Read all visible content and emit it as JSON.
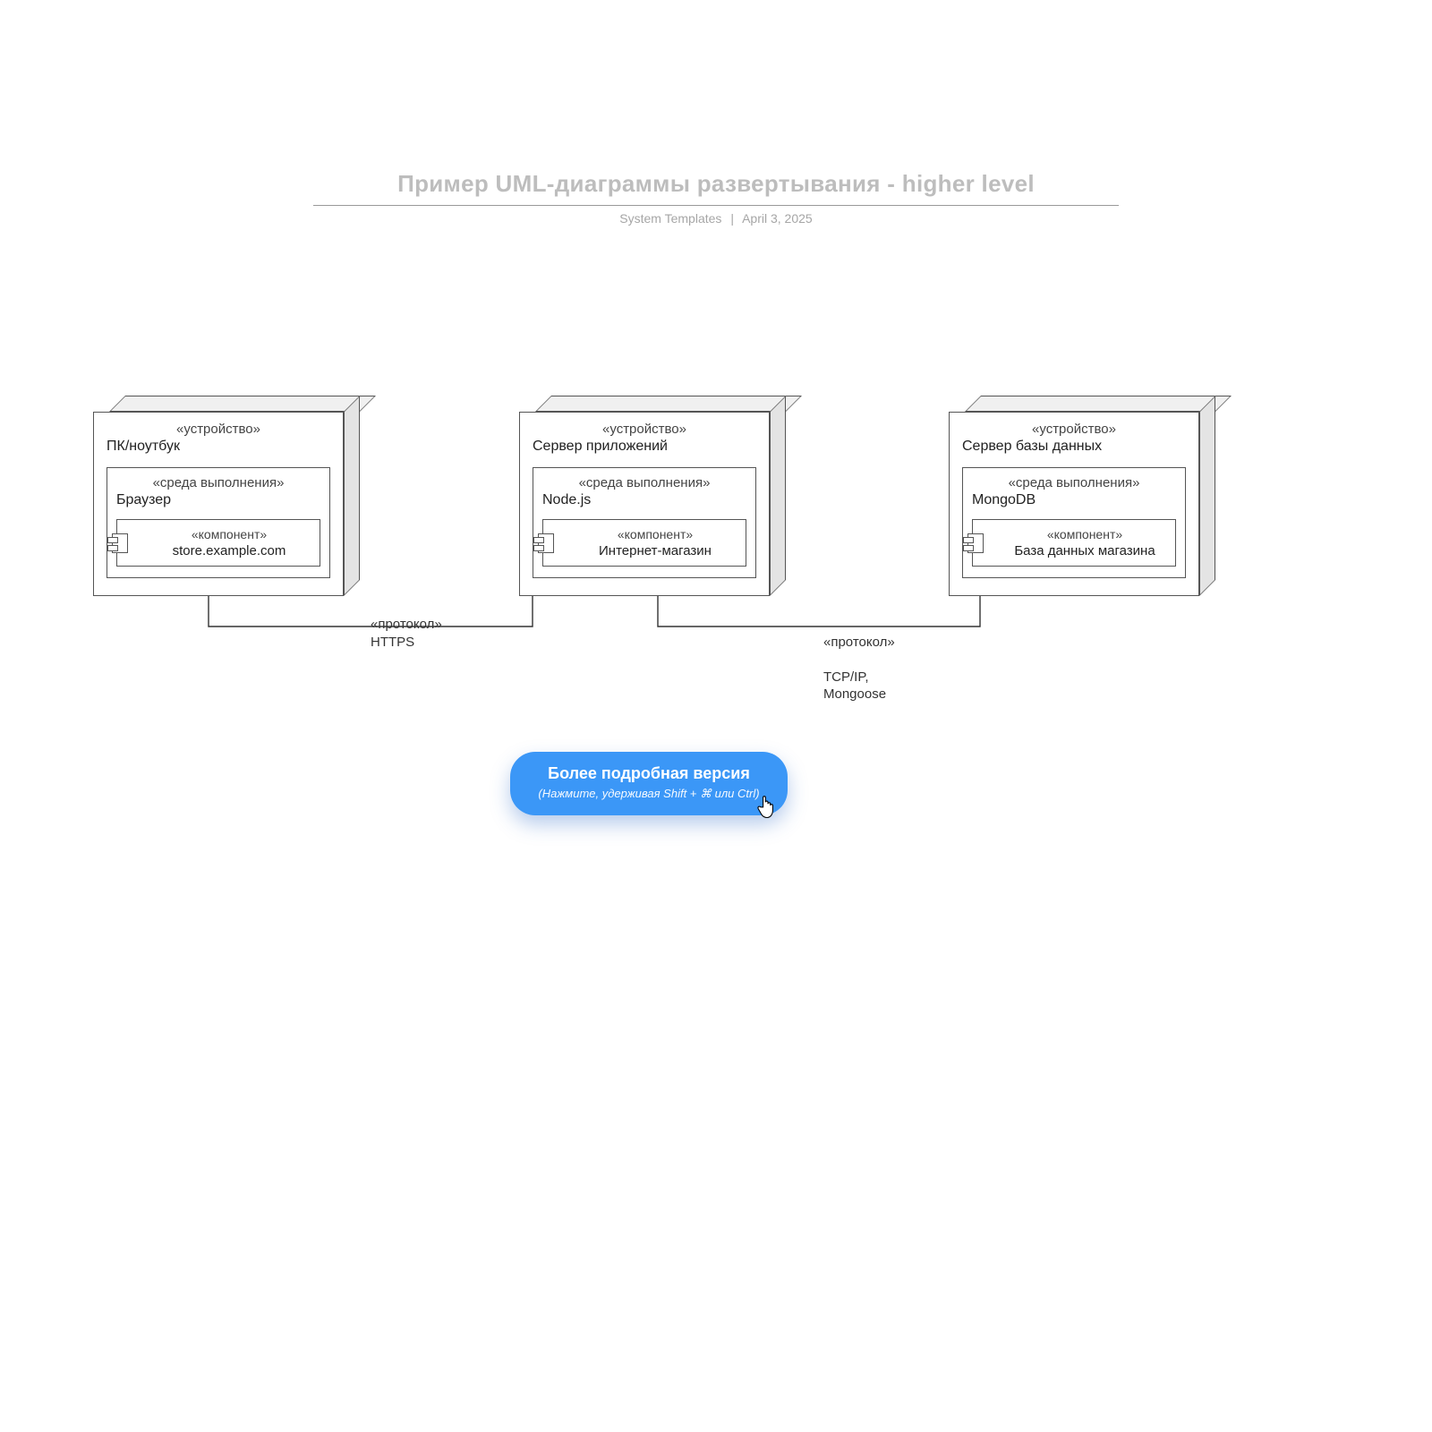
{
  "header": {
    "title": "Пример UML-диаграммы развертывания - higher level",
    "author": "System Templates",
    "date": "April 3, 2025"
  },
  "stereotypes": {
    "device": "«устройство»",
    "env": "«среда выполнения»",
    "component": "«компонент»",
    "protocol": "«протокол»"
  },
  "nodes": {
    "pc": {
      "name": "ПК/ноутбук",
      "env": "Браузер",
      "component": "store.example.com"
    },
    "appserver": {
      "name": "Сервер приложений",
      "env": "Node.js",
      "component": "Интернет-магазин"
    },
    "dbserver": {
      "name": "Сервер базы данных",
      "env": "MongoDB",
      "component": "База данных магазина"
    }
  },
  "connections": {
    "pc_app": "HTTPS",
    "app_db": "TCP/IP,\nMongoose"
  },
  "cta": {
    "title": "Более подробная версия",
    "sub": "(Нажмите, удерживая Shift + ⌘ или Ctrl)"
  }
}
